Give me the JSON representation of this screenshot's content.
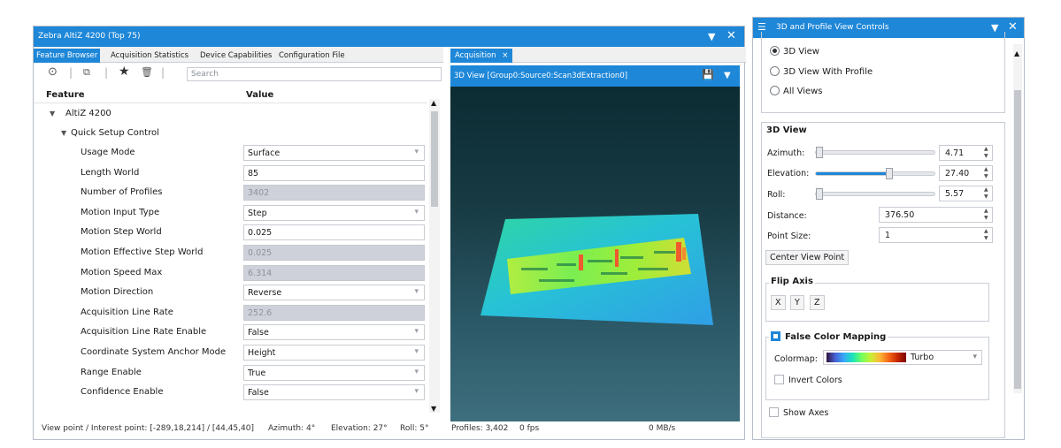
{
  "left_window": {
    "title": "Zebra AltiZ 4200 (Top 75)",
    "dropdown_icon": "▼",
    "close_icon": "✕",
    "tabs": [
      "Feature Browser",
      "Acquisition Statistics",
      "Device Capabilities",
      "Configuration File"
    ],
    "toolbar": {
      "expand_icon": "⊙",
      "export_icon": "⧉",
      "star_icon": "★",
      "delete_icon": "🗑",
      "separator": "|",
      "search_placeholder": "Search"
    },
    "columns": {
      "feature": "Feature",
      "value": "Value"
    },
    "tree": {
      "device": "AltiZ 4200",
      "group": "Quick Setup Control"
    },
    "rows": [
      {
        "label": "Usage Mode",
        "value": "Surface",
        "kind": "dropdown"
      },
      {
        "label": "Length World",
        "value": "85",
        "kind": "edit"
      },
      {
        "label": "Number of Profiles",
        "value": "3402",
        "kind": "readonly"
      },
      {
        "label": "Motion Input Type",
        "value": "Step",
        "kind": "dropdown"
      },
      {
        "label": "Motion Step World",
        "value": "0.025",
        "kind": "edit"
      },
      {
        "label": "Motion Effective Step World",
        "value": "0.025",
        "kind": "readonly"
      },
      {
        "label": "Motion Speed Max",
        "value": "6.314",
        "kind": "readonly"
      },
      {
        "label": "Motion Direction",
        "value": "Reverse",
        "kind": "dropdown"
      },
      {
        "label": "Acquisition Line Rate",
        "value": "252.6",
        "kind": "readonly"
      },
      {
        "label": "Acquisition Line Rate Enable",
        "value": "False",
        "kind": "dropdown"
      },
      {
        "label": "Coordinate System Anchor Mode",
        "value": "Height",
        "kind": "dropdown"
      },
      {
        "label": "Range Enable",
        "value": "True",
        "kind": "dropdown"
      },
      {
        "label": "Confidence Enable",
        "value": "False",
        "kind": "dropdown"
      }
    ],
    "status": {
      "viewpoint": "View point / Interest point: [-289,18,214] / [44,45,40]",
      "azimuth": "Azimuth: 4°",
      "elevation": "Elevation: 27°",
      "roll": "Roll: 5°",
      "profiles": "Profiles: 3,402",
      "fps": "0 fps",
      "rate": "0 MB/s"
    }
  },
  "acquisition": {
    "tab_label": "Acquisition",
    "tab_close": "×",
    "view_title": "3D View [Group0:Source0:Scan3dExtraction0]",
    "save_icon": "💾",
    "menu_icon": "▼"
  },
  "right_window": {
    "title": "3D and Profile View Controls",
    "settings_icon": "☰",
    "dropdown_icon": "▼",
    "close_icon": "✕",
    "view_options": [
      "3D View",
      "3D View With Profile",
      "All Views"
    ],
    "selected_view": 0,
    "view_group": "3D View",
    "azimuth_label": "Azimuth:",
    "azimuth_value": "4.71",
    "azimuth_fraction": 0.02,
    "elevation_label": "Elevation:",
    "elevation_value": "27.40",
    "elevation_fraction": 0.62,
    "roll_label": "Roll:",
    "roll_value": "5.57",
    "roll_fraction": 0.03,
    "distance_label": "Distance:",
    "distance_value": "376.50",
    "point_size_label": "Point Size:",
    "point_size_value": "1",
    "center_button": "Center View Point",
    "flip_group": "Flip Axis",
    "flip_x": "X",
    "flip_y": "Y",
    "flip_z": "Z",
    "false_color_group": "False Color Mapping",
    "false_color_checked": true,
    "colormap_label": "Colormap:",
    "colormap_value": "Turbo",
    "invert_label": "Invert Colors",
    "invert_checked": false,
    "show_axes_label": "Show Axes",
    "show_axes_checked": false
  },
  "colors": {
    "accent": "#1e87d8",
    "readonly_bg": "#ced1d9",
    "viewport_top": "#0c2c33",
    "viewport_bottom": "#3e6f7e"
  }
}
